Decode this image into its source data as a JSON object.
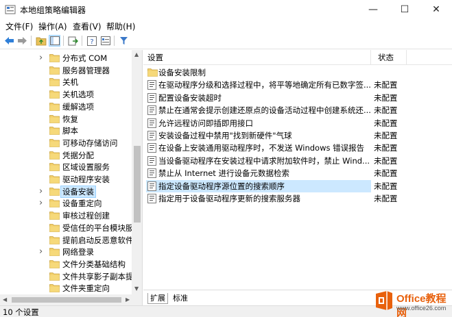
{
  "window": {
    "title": "本地组策略编辑器",
    "minimize_glyph": "—",
    "maximize_glyph": "☐",
    "close_glyph": "✕"
  },
  "menu": [
    "文件(F)",
    "操作(A)",
    "查看(V)",
    "帮助(H)"
  ],
  "toolbar": {
    "icons": [
      "back-icon",
      "forward-icon",
      "up-folder-icon",
      "show-hide-tree-icon",
      "export-list-icon",
      "help-icon",
      "properties-icon",
      "filter-icon"
    ]
  },
  "tree": {
    "items": [
      {
        "label": "分布式 COM",
        "expandable": true
      },
      {
        "label": "服务器管理器",
        "expandable": false
      },
      {
        "label": "关机",
        "expandable": false
      },
      {
        "label": "关机选项",
        "expandable": false
      },
      {
        "label": "缓解选项",
        "expandable": false
      },
      {
        "label": "恢复",
        "expandable": false
      },
      {
        "label": "脚本",
        "expandable": false
      },
      {
        "label": "可移动存储访问",
        "expandable": false
      },
      {
        "label": "凭据分配",
        "expandable": false
      },
      {
        "label": "区域设置服务",
        "expandable": false
      },
      {
        "label": "驱动程序安装",
        "expandable": false
      },
      {
        "label": "设备安装",
        "expandable": true,
        "selected": true
      },
      {
        "label": "设备重定向",
        "expandable": true
      },
      {
        "label": "审核过程创建",
        "expandable": false
      },
      {
        "label": "受信任的平台模块服务",
        "expandable": false
      },
      {
        "label": "提前启动反恶意软件",
        "expandable": false
      },
      {
        "label": "网络登录",
        "expandable": true
      },
      {
        "label": "文件分类基础结构",
        "expandable": false
      },
      {
        "label": "文件共享影子副本提供",
        "expandable": false
      },
      {
        "label": "文件夹重定向",
        "expandable": false
      }
    ]
  },
  "list": {
    "headers": {
      "setting": "设置",
      "state": "状态"
    },
    "rows": [
      {
        "type": "folder",
        "label": "设备安装限制",
        "state": ""
      },
      {
        "type": "policy",
        "label": "在驱动程序分级和选择过程中，将平等地确定所有已数字签...",
        "state": "未配置"
      },
      {
        "type": "policy",
        "label": "配置设备安装超时",
        "state": "未配置"
      },
      {
        "type": "policy",
        "label": "禁止在通常会提示创建还原点的设备活动过程中创建系统还...",
        "state": "未配置"
      },
      {
        "type": "policy",
        "label": "允许远程访问即插即用接口",
        "state": "未配置"
      },
      {
        "type": "policy",
        "label": "安装设备过程中禁用\"找到新硬件\"气球",
        "state": "未配置"
      },
      {
        "type": "policy",
        "label": "在设备上安装通用驱动程序时，不发送 Windows 错误报告",
        "state": "未配置"
      },
      {
        "type": "policy",
        "label": "当设备驱动程序在安装过程中请求附加软件时，禁止 Wind...",
        "state": "未配置"
      },
      {
        "type": "policy",
        "label": "禁止从 Internet 进行设备元数据检索",
        "state": "未配置"
      },
      {
        "type": "policy",
        "label": "指定设备驱动程序源位置的搜索顺序",
        "state": "未配置",
        "selected": true
      },
      {
        "type": "policy",
        "label": "指定用于设备驱动程序更新的搜索服务器",
        "state": "未配置"
      }
    ]
  },
  "tabs": [
    "扩展",
    "标准"
  ],
  "status": "10 个设置",
  "watermark": {
    "title": "Office教程网",
    "url": "www.office26.com"
  },
  "colors": {
    "selection": "#cce8ff",
    "folder": "#e8c15a",
    "brand": "#e8610d"
  }
}
